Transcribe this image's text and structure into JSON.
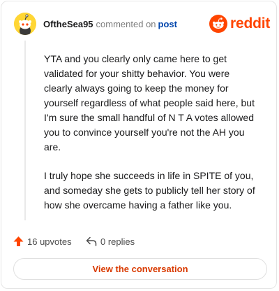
{
  "comment": {
    "username": "OftheSea95",
    "action_text": "commented on",
    "post_link_label": "post",
    "brand_label": "reddit",
    "paragraphs": [
      "YTA and you clearly only came here to get validated for your shitty behavior. You were clearly always going to keep the money for yourself regardless of what people said here, but I'm sure the small handful of N T A votes allowed you to convince yourself you're not the AH you are.",
      "I truly hope she succeeds in life in SPITE of you, and someday she gets to publicly tell her story of how she overcame having a father like you."
    ]
  },
  "footer": {
    "upvotes_label": "16 upvotes",
    "replies_label": "0 replies",
    "view_button_label": "View the conversation"
  },
  "icons": {
    "avatar": "snoo-avatar-icon",
    "logo": "reddit-logo-icon",
    "upvote": "upvote-arrow-icon",
    "reply": "reply-arrow-icon"
  },
  "colors": {
    "accent": "#ff4500",
    "link": "#0045ac",
    "button_text": "#d93a00",
    "avatar_bg": "#ffd635"
  }
}
